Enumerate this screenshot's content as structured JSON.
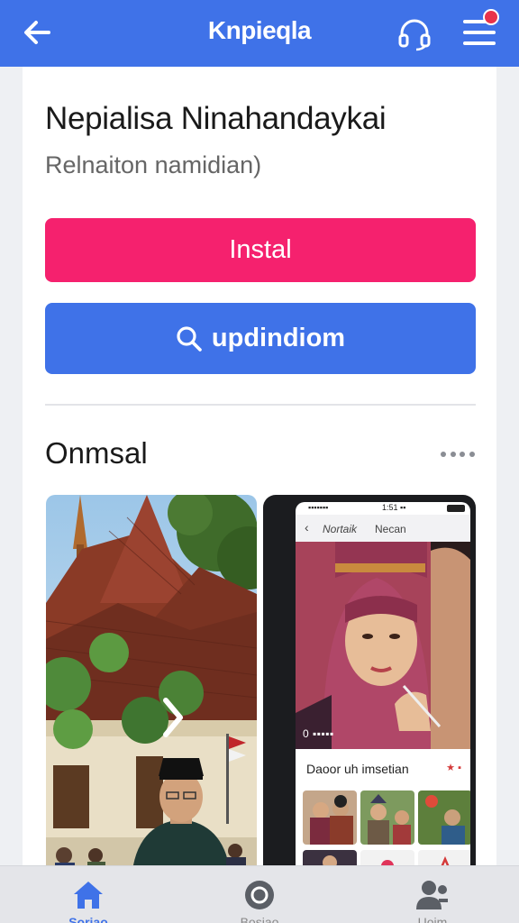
{
  "header": {
    "title": "Knpieqla",
    "back_icon": "arrow-left-icon",
    "support_icon": "headset-icon",
    "menu_icon": "hamburger-menu-icon",
    "notification_color": "#e8334a"
  },
  "app": {
    "name": "Nepialisa Ninahandaykai",
    "subtitle": "Relnaiton namidian)"
  },
  "actions": {
    "install_label": "Instal",
    "update_label": "updindiom",
    "install_color": "#f5216e",
    "update_color": "#3f72e8"
  },
  "screenshots": {
    "title": "Onmsal",
    "more_icon": "more-dots-icon",
    "phone": {
      "status_left": "▪▪▪▪▪▪▪",
      "status_center": "1:51 ▪▪",
      "nav_left": "Nortaik",
      "nav_right": "Necan",
      "hero_time": "0 ▪▪▪▪▪",
      "section_label": "Daoor uh imsetian",
      "section_mark": "★ ▪"
    }
  },
  "bottom_nav": {
    "items": [
      {
        "label": "Soriao",
        "icon": "home-icon",
        "active": true
      },
      {
        "label": "Bosiao",
        "icon": "circle-icon",
        "active": false
      },
      {
        "label": "Uoim",
        "icon": "users-icon",
        "active": false
      }
    ]
  },
  "colors": {
    "brand": "#3f72e8",
    "accent": "#f5216e"
  }
}
